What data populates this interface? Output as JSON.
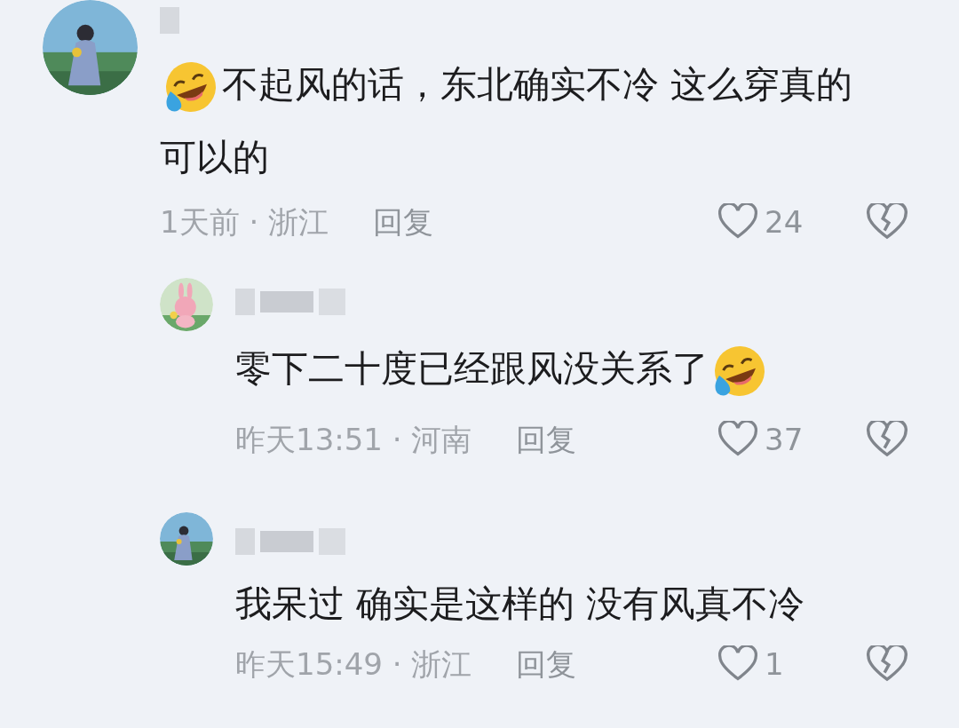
{
  "comments": [
    {
      "kind": "comment",
      "emoji_before": true,
      "emoji_after": false,
      "text": "不起风的话，东北确实不冷 这么穿真的可以的",
      "meta": "1天前 · 浙江",
      "reply": "回复",
      "likes": "24"
    },
    {
      "kind": "reply",
      "emoji_before": false,
      "emoji_after": true,
      "text": "零下二十度已经跟风没关系了",
      "meta": "昨天13:51 · 河南",
      "reply": "回复",
      "likes": "37"
    },
    {
      "kind": "reply",
      "text": "我呆过 确实是这样的 没有风真不冷",
      "meta": "昨天15:49 · 浙江",
      "reply": "回复",
      "likes": "1"
    }
  ]
}
